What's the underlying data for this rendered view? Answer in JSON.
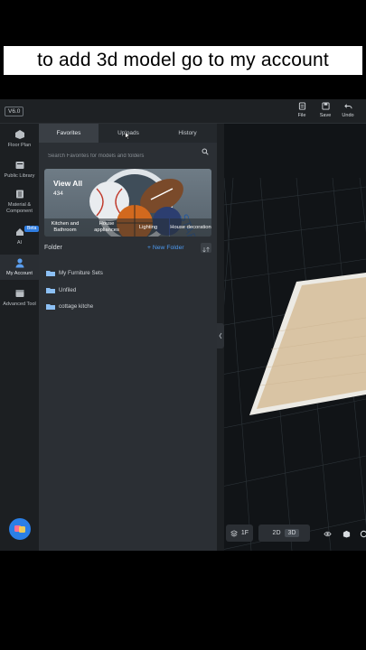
{
  "caption": "to add 3d model go to my account",
  "app": {
    "version": "V6.0",
    "toolbar": [
      {
        "label": "File",
        "icon": "file-icon"
      },
      {
        "label": "Save",
        "icon": "save-icon"
      },
      {
        "label": "Undo",
        "icon": "undo-icon"
      }
    ]
  },
  "nav": [
    {
      "label": "Floor Plan",
      "icon": "floor-plan-icon"
    },
    {
      "label": "Public Library",
      "icon": "public-library-icon"
    },
    {
      "label": "Material & Component",
      "icon": "material-component-icon"
    },
    {
      "label": "AI",
      "icon": "ai-icon",
      "badge": "Beta"
    },
    {
      "label": "My Account",
      "icon": "user-icon",
      "active": true
    },
    {
      "label": "Advanced Tool",
      "icon": "advanced-tool-icon"
    }
  ],
  "panel": {
    "tabs": [
      "Favorites",
      "Uploads",
      "History"
    ],
    "active_tab": "Favorites",
    "search_placeholder": "Search Favorites for models and folders",
    "banner": {
      "view_all": "View All",
      "count": "434",
      "categories": [
        "Kitchen and Bathroom",
        "House appliances",
        "Lighting",
        "House decoration"
      ]
    },
    "folder_title": "Folder",
    "new_folder": "+ New Folder",
    "folders": [
      "My Furniture Sets",
      "Unfiled",
      "cottage kitche"
    ]
  },
  "viewport": {
    "floor_label": "1F",
    "view_2d": "2D",
    "view_3d": "3D",
    "active_view": "3D"
  },
  "colors": {
    "accent": "#4d9af0",
    "panel": "#2b2f34",
    "floor": "#d9c4a4"
  }
}
